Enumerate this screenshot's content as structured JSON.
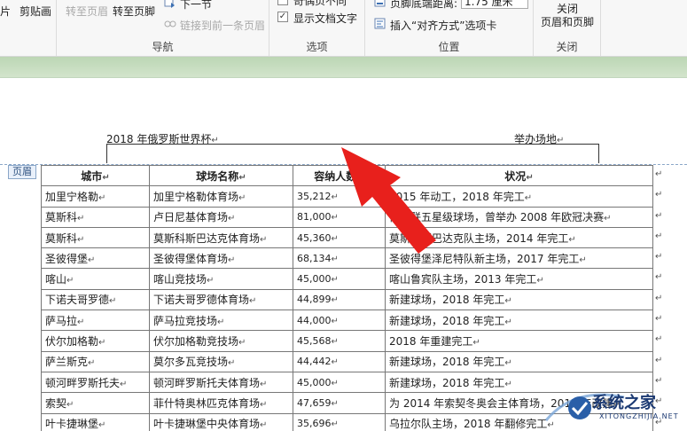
{
  "ribbon": {
    "clipboard_partial": "片",
    "clipboard_label": "剪贴画",
    "nav": {
      "goto_header": "转至页眉",
      "goto_footer": "转至页脚",
      "next_section": "下一节",
      "link_previous": "链接到前一条页眉",
      "group_label": "导航"
    },
    "options": {
      "option_top_partial": "奇偶页不同",
      "show_doc_text": "显示文档文字",
      "group_label": "选项"
    },
    "position": {
      "footer_distance_label": "页脚底端距离:",
      "footer_distance_value": "1.75 厘米",
      "insert_align_tab": "插入“对齐方式”选项卡",
      "group_label": "位置"
    },
    "close": {
      "close_label_1": "关闭",
      "close_label_2": "页眉和页脚",
      "group_label": "关闭"
    }
  },
  "document": {
    "header_title": "2018 年俄罗斯世界杯",
    "header_right": "举办场地",
    "header_tag": "页眉",
    "para_mark": "↵",
    "table": {
      "columns": [
        "城市",
        "球场名称",
        "容纳人数",
        "状况"
      ],
      "rows": [
        [
          "加里宁格勒",
          "加里宁格勒体育场",
          "35,212",
          "2015 年动工，2018 年完工"
        ],
        [
          "莫斯科",
          "卢日尼基体育场",
          "81,000",
          "俄足联五星级球场，曾举办 2008 年欧冠决赛"
        ],
        [
          "莫斯科",
          "莫斯科斯巴达克体育场",
          "45,360",
          "莫斯科斯巴达克队主场，2014 年完工"
        ],
        [
          "圣彼得堡",
          "圣彼得堡体育场",
          "68,134",
          "圣彼得堡泽尼特队新主场，2017 年完工"
        ],
        [
          "喀山",
          "喀山竞技场",
          "45,000",
          "喀山鲁宾队主场，2013 年完工"
        ],
        [
          "下诺夫哥罗德",
          "下诺夫哥罗德体育场",
          "44,899",
          "新建球场，2018 年完工"
        ],
        [
          "萨马拉",
          "萨马拉竞技场",
          "44,000",
          "新建球场，2018 年完工"
        ],
        [
          "伏尔加格勒",
          "伏尔加格勒竞技场",
          "45,568",
          "2018 年重建完工"
        ],
        [
          "萨兰斯克",
          "莫尔多瓦竞技场",
          "44,442",
          "新建球场，2018 年完工"
        ],
        [
          "顿河畔罗斯托夫",
          "顿河畔罗斯托夫体育场",
          "45,000",
          "新建球场，2018 年完工"
        ],
        [
          "索契",
          "菲什特奥林匹克体育场",
          "47,659",
          "为 2014 年索契冬奥会主体育场，2017 年改建"
        ],
        [
          "叶卡捷琳堡",
          "叶卡捷琳堡中央体育场",
          "35,696",
          "乌拉尔队主场，2018 年翻修完工"
        ]
      ]
    }
  },
  "watermark": {
    "brand": "系统之家",
    "url": "XITONGZHIJIA.NET"
  },
  "colors": {
    "arrow": "#e8201c",
    "band": "#c8dec0",
    "header_dash": "#8aa6c8",
    "watermark": "#1c3a73"
  }
}
